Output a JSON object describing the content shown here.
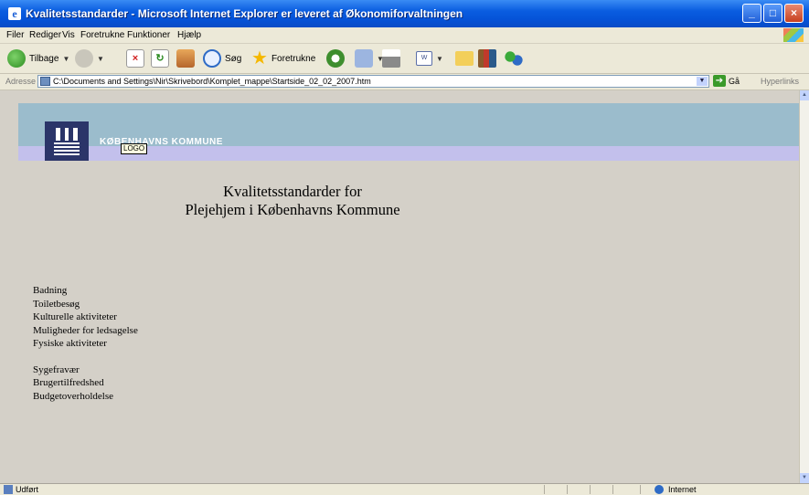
{
  "window": {
    "title": "Kvalitetsstandarder - Microsoft Internet Explorer er leveret af Økonomiforvaltningen",
    "buttons": [
      "minimize",
      "maximize",
      "close"
    ]
  },
  "menu": {
    "items": [
      "Filer",
      "Rediger",
      "Vis",
      "Foretrukne",
      "Funktioner",
      "Hjælp"
    ]
  },
  "toolbar": {
    "back_label": "Tilbage",
    "search_label": "Søg",
    "favorites_label": "Foretrukne"
  },
  "address": {
    "label": "Adresse",
    "value": "C:\\Documents and Settings\\Nir\\Skrivebord\\Komplet_mappe\\Startside_02_02_2007.htm",
    "go_label": "Gå",
    "links_label": "Hyperlinks"
  },
  "page": {
    "banner_text": "KØBENHAVNS KOMMUNE",
    "logo_tooltip": "LOGO",
    "heading_line1": "Kvalitetsstandarder for",
    "heading_line2": "Plejehjem i Københavns Kommune",
    "links_group1": [
      "Badning",
      "Toiletbesøg",
      "Kulturelle aktiviteter",
      "Muligheder for ledsagelse",
      "Fysiske aktiviteter"
    ],
    "links_group2": [
      "Sygefravær",
      "Brugertilfredshed",
      "Budgetoverholdelse"
    ]
  },
  "status": {
    "text": "Udført",
    "zone": "Internet"
  },
  "colors": {
    "titlebar": "#0a5de0",
    "banner": "#9bbccc",
    "banner_strip": "#c3c0ec",
    "crest": "#2b3569",
    "page_bg": "#d4d0c8"
  }
}
